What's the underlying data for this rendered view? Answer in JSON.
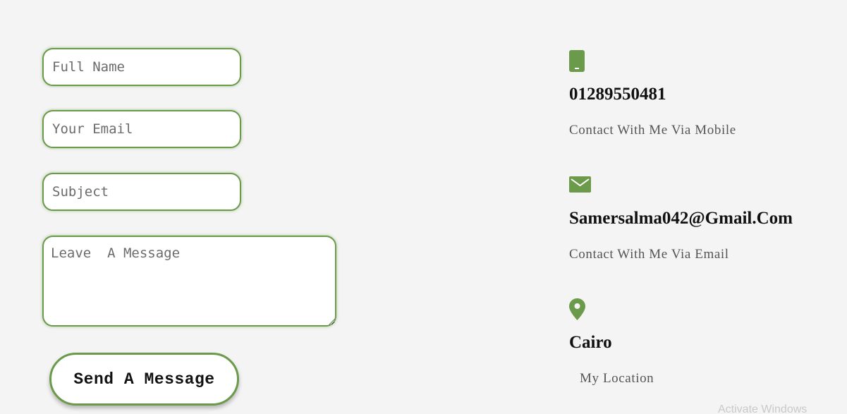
{
  "form": {
    "name_placeholder": "Full Name",
    "email_placeholder": "Your Email",
    "subject_placeholder": "Subject",
    "message_placeholder": "Leave  A Message",
    "send_label": "Send A Message"
  },
  "contact": {
    "phone": {
      "icon": "mobile-phone-icon",
      "title": "01289550481",
      "subtitle": "Contact With Me Via Mobile"
    },
    "email": {
      "icon": "envelope-icon",
      "title": "Samersalma042@Gmail.Com",
      "subtitle": "Contact With Me Via Email"
    },
    "location": {
      "icon": "map-pin-icon",
      "title": "Cairo",
      "subtitle": "My Location"
    }
  },
  "watermark": "Activate Windows",
  "colors": {
    "accent": "#6a9a4a",
    "background": "#f4f4f4",
    "field_background": "#ffffff"
  }
}
